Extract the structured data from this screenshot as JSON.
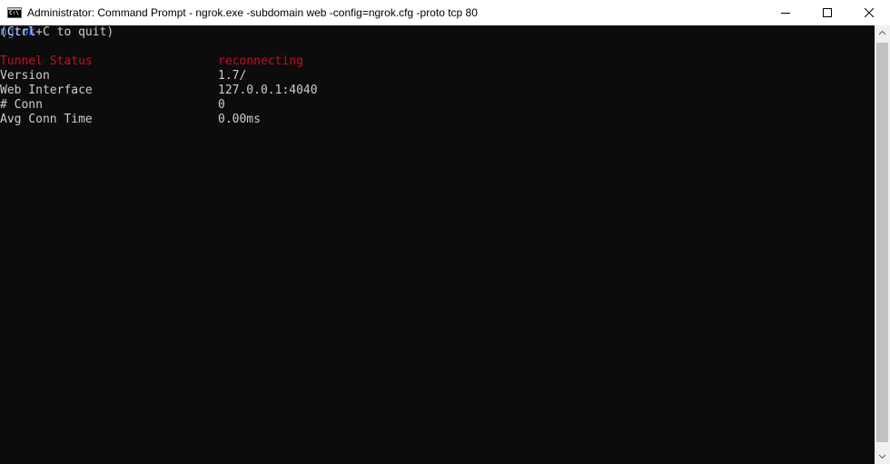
{
  "window": {
    "title": "Administrator: Command Prompt - ngrok.exe  -subdomain web -config=ngrok.cfg -proto tcp 80",
    "icon": "cmd-icon",
    "controls": [
      "minimize-icon",
      "maximize-icon",
      "close-icon"
    ]
  },
  "console": {
    "app_name": "ngrok",
    "quit_hint": "(Ctrl+C to quit)",
    "status_rows": [
      {
        "label": "Tunnel Status",
        "value": "reconnecting"
      },
      {
        "label": "Version",
        "value": "1.7/"
      },
      {
        "label": "Web Interface",
        "value": "127.0.0.1:4040"
      },
      {
        "label": "# Conn",
        "value": "0"
      },
      {
        "label": "Avg Conn Time",
        "value": "0.00ms"
      }
    ]
  },
  "colors": {
    "console_bg": "#0c0c0c",
    "console_text": "#cccccc",
    "app_name": "#3b78ff",
    "status_alert": "#c50f1f"
  }
}
